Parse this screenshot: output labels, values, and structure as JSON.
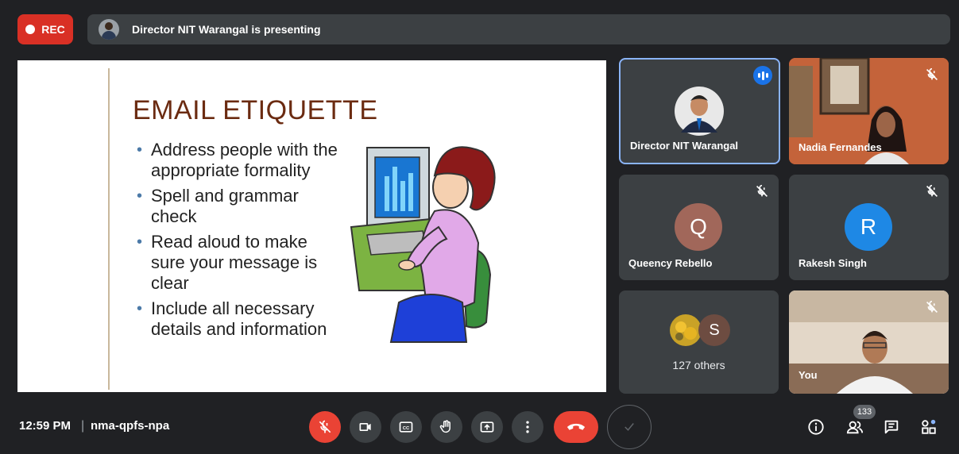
{
  "top_bar": {
    "rec_label": "REC",
    "presenting_text": "Director NIT Warangal is presenting"
  },
  "slide": {
    "title": "EMAIL ETIQUETTE",
    "bullets": [
      "Address people with the appropriate formality",
      "Spell and grammar check",
      "Read aloud to make sure your message is clear",
      "Include all necessary details and information"
    ]
  },
  "participants": {
    "director": {
      "name": "Director NIT Warangal"
    },
    "nadia": {
      "name": "Nadia Fernandes"
    },
    "queency": {
      "name": "Queency Rebello",
      "initial": "Q",
      "color": "#a1675a"
    },
    "rakesh": {
      "name": "Rakesh Singh",
      "initial": "R",
      "color": "#1e88e5"
    },
    "others": {
      "label": "127 others",
      "initial": "S",
      "color": "#6d4c41"
    },
    "you": {
      "name": "You"
    }
  },
  "bottom_bar": {
    "time": "12:59 PM",
    "separator": "|",
    "meeting_code": "nma-qpfs-npa",
    "people_count": "133"
  },
  "colors": {
    "background": "#202124",
    "tile": "#3c4043",
    "rec": "#d93025",
    "end_call": "#ea4335",
    "active_speaker": "#8ab4f8"
  }
}
